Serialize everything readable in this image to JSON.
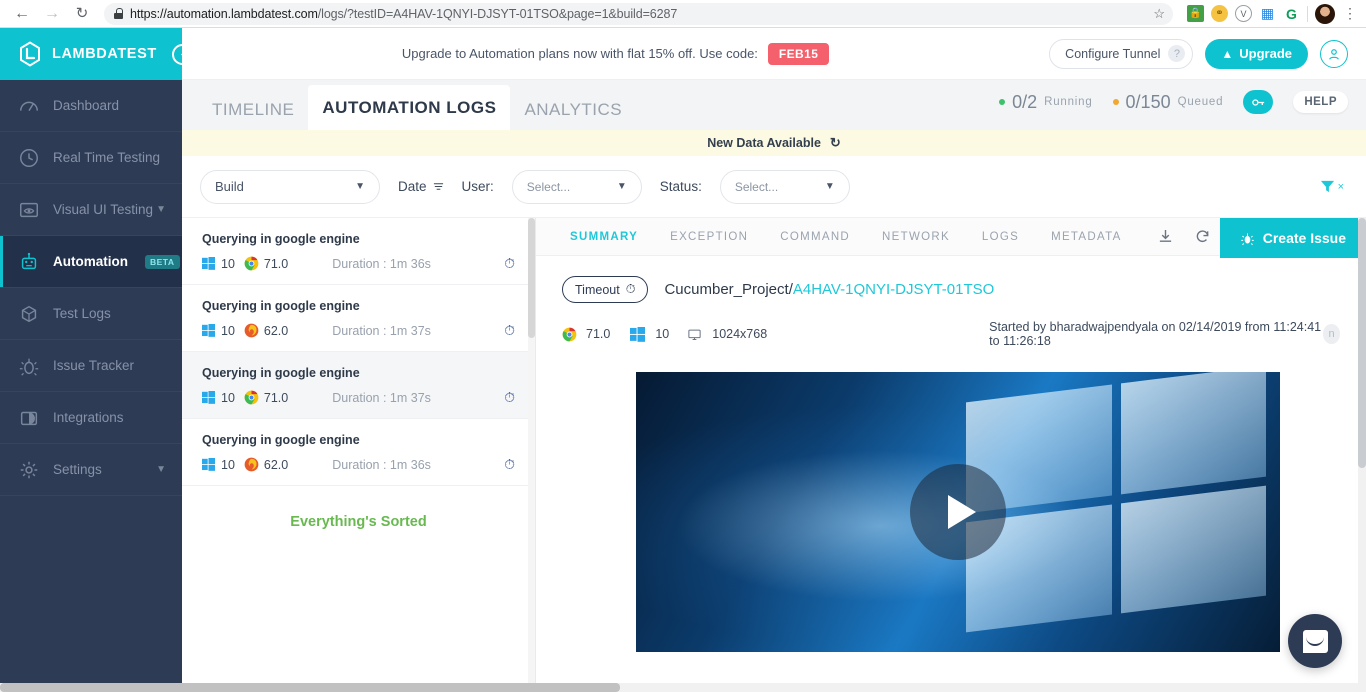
{
  "browser": {
    "back_icon": "back-arrow-icon",
    "forward_icon": "forward-arrow-icon",
    "reload_icon": "reload-icon",
    "url_main": "https://automation.lambdatest.com",
    "url_path": "/logs/?testID=A4HAV-1QNYI-DJSYT-01TSO&page=1&build=6287",
    "star": "☆",
    "extensions": [
      "lastpass-icon",
      "key-icon",
      "v-circle-icon",
      "windows-icon",
      "grammarly-icon"
    ],
    "menu_icon": "⋮"
  },
  "brand": {
    "name": "LAMBDATEST",
    "collapse": "‹"
  },
  "sidebar": {
    "items": [
      {
        "label": "Dashboard",
        "icon": "speedometer-icon",
        "active": false,
        "badge": "",
        "caret": false
      },
      {
        "label": "Real Time Testing",
        "icon": "clock-icon",
        "active": false,
        "badge": "",
        "caret": false
      },
      {
        "label": "Visual UI Testing",
        "icon": "eye-window-icon",
        "active": false,
        "badge": "",
        "caret": true
      },
      {
        "label": "Automation",
        "icon": "robot-icon",
        "active": true,
        "badge": "BETA",
        "caret": false
      },
      {
        "label": "Test Logs",
        "icon": "box-icon",
        "active": false,
        "badge": "",
        "caret": false
      },
      {
        "label": "Issue Tracker",
        "icon": "bug-icon",
        "active": false,
        "badge": "",
        "caret": false
      },
      {
        "label": "Integrations",
        "icon": "integrations-icon",
        "active": false,
        "badge": "",
        "caret": false
      },
      {
        "label": "Settings",
        "icon": "gear-icon",
        "active": false,
        "badge": "",
        "caret": true
      }
    ]
  },
  "topbar": {
    "promo_text": "Upgrade to Automation plans now with flat 15% off. Use code:",
    "promo_code": "FEB15",
    "tunnel_label": "Configure Tunnel",
    "tunnel_help": "?",
    "upgrade_label": "Upgrade",
    "user_icon": "user-circle-icon"
  },
  "tabs": [
    {
      "label": "TIMELINE",
      "active": false
    },
    {
      "label": "AUTOMATION LOGS",
      "active": true
    },
    {
      "label": "ANALYTICS",
      "active": false
    }
  ],
  "status": {
    "running_value": "0/2",
    "running_label": "Running",
    "running_color": "#3ec16c",
    "queued_value": "0/150",
    "queued_label": "Queued",
    "queued_color": "#f0a830",
    "key_icon": "key-icon",
    "help_label": "HELP"
  },
  "banner": {
    "text": "New Data Available",
    "refresh_icon": "↻"
  },
  "filters": {
    "build_value": "Build",
    "date_label": "Date",
    "user_label": "User:",
    "user_value": "Select...",
    "status_label": "Status:",
    "status_value": "Select...",
    "funnel_icon": "funnel-icon",
    "clear_icon": "×"
  },
  "test_list": {
    "items": [
      {
        "title": "Querying in google engine",
        "os": "windows",
        "os_version": "10",
        "browser": "chrome",
        "browser_version": "71.0",
        "duration": "Duration : 1m 36s",
        "selected": false
      },
      {
        "title": "Querying in google engine",
        "os": "windows",
        "os_version": "10",
        "browser": "firefox",
        "browser_version": "62.0",
        "duration": "Duration : 1m 37s",
        "selected": false
      },
      {
        "title": "Querying in google engine",
        "os": "windows",
        "os_version": "10",
        "browser": "chrome",
        "browser_version": "71.0",
        "duration": "Duration : 1m 37s",
        "selected": true
      },
      {
        "title": "Querying in google engine",
        "os": "windows",
        "os_version": "10",
        "browser": "firefox",
        "browser_version": "62.0",
        "duration": "Duration : 1m 36s",
        "selected": false
      }
    ],
    "footer": "Everything's Sorted"
  },
  "detail": {
    "tabs": [
      {
        "label": "SUMMARY",
        "active": true
      },
      {
        "label": "EXCEPTION",
        "active": false
      },
      {
        "label": "COMMAND",
        "active": false
      },
      {
        "label": "NETWORK",
        "active": false
      },
      {
        "label": "LOGS",
        "active": false
      },
      {
        "label": "METADATA",
        "active": false
      }
    ],
    "download_icon": "download-icon",
    "refresh_icon": "refresh-icon",
    "create_issue_label": "Create Issue",
    "status_pill": "Timeout",
    "project_name": "Cucumber_Project/",
    "test_id": "A4HAV-1QNYI-DJSYT-01TSO",
    "browser_version": "71.0",
    "os_version": "10",
    "resolution": "1024x768",
    "started_by": "Started by bharadwajpendyala on 02/14/2019 from 11:24:41 to 11:26:18",
    "avatar_letter": "n",
    "play_label": "play-button"
  },
  "chat": {
    "icon": "intercom-chat-icon"
  }
}
